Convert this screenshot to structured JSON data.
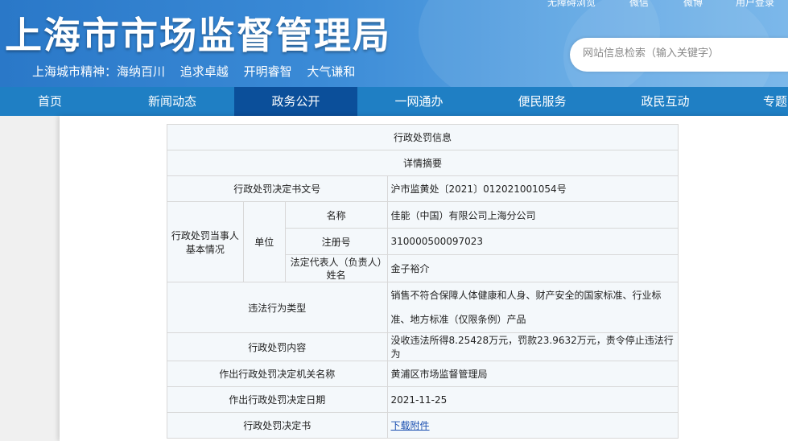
{
  "header": {
    "top_links": [
      "无障碍浏览",
      "微信",
      "微博",
      "用户登录"
    ],
    "title": "上海市市场监督管理局",
    "slogan": [
      "上海城市精神：海纳百川",
      "追求卓越",
      "开明睿智",
      "大气谦和"
    ],
    "search_placeholder": "网站信息检索（输入关键字）"
  },
  "nav": {
    "items": [
      "首页",
      "新闻动态",
      "政务公开",
      "一网通办",
      "便民服务",
      "政民互动",
      "专题"
    ],
    "active_index": 2
  },
  "record": {
    "title": "行政处罚信息",
    "subtitle": "详情摘要",
    "rows": {
      "doc_no_label": "行政处罚决定书文号",
      "doc_no_value": "沪市监黄处〔2021〕012021001054号",
      "party_label": "行政处罚当事人基本情况",
      "unit_label": "单位",
      "name_label": "名称",
      "name_value": "佳能（中国）有限公司上海分公司",
      "reg_label": "注册号",
      "reg_value": "310000500097023",
      "rep_label": "法定代表人（负责人）姓名",
      "rep_value": "金子裕介",
      "violation_label": "违法行为类型",
      "violation_value": "销售不符合保障人体健康和人身、财产安全的国家标准、行业标准、地方标准（仅限条例）产品",
      "content_label": "行政处罚内容",
      "content_value": "没收违法所得8.25428万元，罚款23.9632万元，责令停止违法行为",
      "authority_label": "作出行政处罚决定机关名称",
      "authority_value": "黄浦区市场监督管理局",
      "date_label": "作出行政处罚决定日期",
      "date_value": "2021-11-25",
      "decision_label": "行政处罚决定书",
      "decision_link": "下载附件"
    }
  },
  "colors": {
    "banner": "#3a8ad6",
    "nav": "#1f7fc4",
    "nav_active": "#0b4f9a",
    "link": "#1a4fb0"
  }
}
